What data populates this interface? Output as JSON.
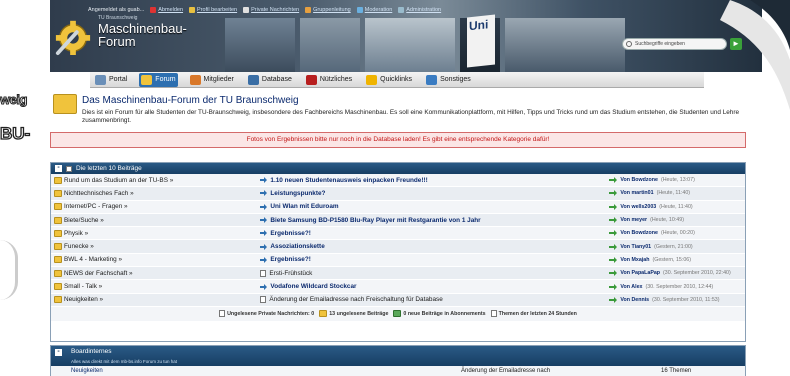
{
  "header": {
    "topbar": [
      {
        "label": "Angemeldet als guab...",
        "icon": "user-icon"
      },
      {
        "label": "Abmelden",
        "icon": "logout-icon"
      },
      {
        "label": "Profil bearbeiten",
        "icon": "pencil-icon"
      },
      {
        "label": "Private Nachrichten",
        "icon": "mail-icon"
      },
      {
        "label": "Gruppenleitung",
        "icon": "group-icon"
      },
      {
        "label": "Moderation",
        "icon": "moderation-icon"
      },
      {
        "label": "Administration",
        "icon": "admin-icon"
      }
    ],
    "logo_small": "TU Braunschweig",
    "logo_line1": "Maschinenbau-",
    "logo_line2": "Forum",
    "sign": "Uni",
    "search_placeholder": "Suchbegriffe eingeben",
    "search_go": "►"
  },
  "nav": {
    "items": [
      {
        "label": "Portal",
        "icon": "portal-icon",
        "color": "#6a8fb8",
        "active": false
      },
      {
        "label": "Forum",
        "icon": "forum-folder-icon",
        "color": "#f0c33c",
        "active": true
      },
      {
        "label": "Mitglieder",
        "icon": "members-icon",
        "color": "#d9782a",
        "active": false
      },
      {
        "label": "Database",
        "icon": "database-icon",
        "color": "#3a6ea5",
        "active": false
      },
      {
        "label": "Nützliches",
        "icon": "useful-icon",
        "color": "#b81f1f",
        "active": false
      },
      {
        "label": "Quicklinks",
        "icon": "star-icon",
        "color": "#f0b400",
        "active": false
      },
      {
        "label": "Sonstiges",
        "icon": "misc-icon",
        "color": "#3a7cc2",
        "active": false
      }
    ]
  },
  "intro": {
    "title": "Das Maschinenbau-Forum der TU Braunschweig",
    "description": "Dies ist ein Forum für alle Studenten der TU-Braunschweig, insbesondere des Fachbereichs Maschinenbau. Es soll eine Kommunikationplattform, mit Hilfen, Tipps und Tricks rund um das Studium entstehen, die Studenten und Lehre zusammenbringt."
  },
  "alert": "Fotos von Ergebnissen bitte nur noch in die Database laden! Es gibt eine entsprechende Kategorie dafür!",
  "latest": {
    "title": "Die letzten 10 Beiträge",
    "rows": [
      {
        "forum": "Rund um das Studium an der TU-BS »",
        "topic": "1.10 neuen Studentenausweis einpacken Freunde!!!",
        "topic_type": "new",
        "user": "Von Bowdzone",
        "time": "(Heute, 13:07)"
      },
      {
        "forum": "Nichttechnisches Fach »",
        "topic": "Leistungspunkte?",
        "topic_type": "new",
        "user": "Von martin01",
        "time": "(Heute, 11:40)"
      },
      {
        "forum": "Internet/PC - Fragen »",
        "topic": "Uni Wlan mit Eduroam",
        "topic_type": "new",
        "user": "Von wells2003",
        "time": "(Heute, 11:40)"
      },
      {
        "forum": "Biete/Suche »",
        "topic": "Biete Samsung BD-P1580 Blu-Ray Player mit Restgarantie von 1 Jahr",
        "topic_type": "new",
        "user": "Von meyer",
        "time": "(Heute, 10:49)"
      },
      {
        "forum": "Physik »",
        "topic": "Ergebnisse?!",
        "topic_type": "new",
        "user": "Von Bowdzone",
        "time": "(Heute, 00:20)"
      },
      {
        "forum": "Funecke »",
        "topic": "Assoziationskette",
        "topic_type": "new",
        "user": "Von Tiany01",
        "time": "(Gestern, 21:00)"
      },
      {
        "forum": "BWL 4 - Marketing »",
        "topic": "Ergebnisse?!",
        "topic_type": "new",
        "user": "Von Mxajah",
        "time": "(Gestern, 15:06)"
      },
      {
        "forum": "NEWS der Fachschaft »",
        "topic": "Ersti-Frühstück",
        "topic_type": "read",
        "user": "Von PapaLaPap",
        "time": "(30. September 2010, 22:40)"
      },
      {
        "forum": "Small - Talk »",
        "topic": "Vodafone Wildcard Stockcar",
        "topic_type": "new",
        "user": "Von Alex",
        "time": "(30. September 2010, 12:44)"
      },
      {
        "forum": "Neuigkeiten »",
        "topic": "Änderung der Emailadresse nach Freischaltung für Database",
        "topic_type": "read",
        "user": "Von Dennis",
        "time": "(30. September 2010, 11:53)"
      }
    ],
    "legend": [
      {
        "label": "Ungelesene Private Nachrichten: 0",
        "icon": "pm-icon"
      },
      {
        "label": "13 ungelesene Beiträge",
        "icon": "unread-folder-icon"
      },
      {
        "label": "0 neue Beiträge in Abonnements",
        "icon": "subscription-icon"
      },
      {
        "label": "Themen der letzten 24 Stunden",
        "icon": "recent-topics-icon"
      }
    ]
  },
  "board": {
    "title": "Boardinternes",
    "subtitle": "Alles was direkt mit dem mb-bs.info Forum zu tun hat",
    "row_forum": "Neuigkeiten",
    "row_last": "Änderung der Emailadresse nach",
    "row_count": "16 Themen"
  },
  "deco": {
    "left1": "weig",
    "left2": "BU-"
  }
}
